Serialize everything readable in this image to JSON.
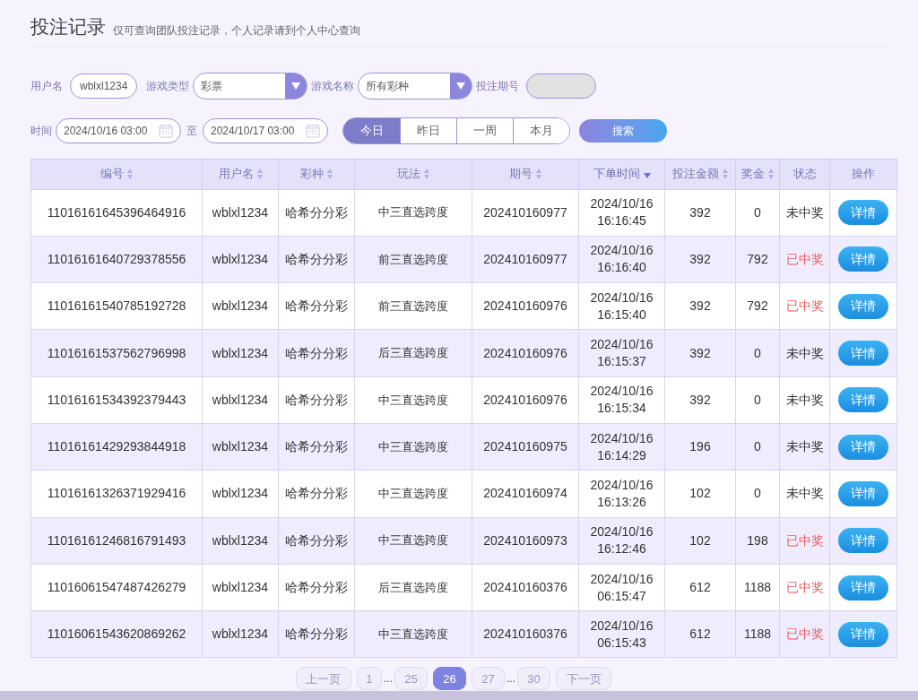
{
  "header": {
    "title": "投注记录",
    "subtitle": "仅可查询团队投注记录，个人记录请到个人中心查询"
  },
  "filters": {
    "username_label": "用户名",
    "username": "wblxl1234",
    "game_type_label": "游戏类型",
    "game_type": "彩票",
    "game_name_label": "游戏名称",
    "game_name": "所有彩种",
    "period_label": "投注期号",
    "time_label": "时间",
    "start_time": "2024/10/16 03:00",
    "to_label": "至",
    "end_time": "2024/10/17 03:00",
    "ranges": [
      {
        "label": "今日",
        "selected": true
      },
      {
        "label": "昨日",
        "selected": false
      },
      {
        "label": "一周",
        "selected": false
      },
      {
        "label": "本月",
        "selected": false
      }
    ],
    "search_button": "搜索"
  },
  "table": {
    "columns": [
      {
        "label": "编号",
        "sortable": true,
        "sorted": false
      },
      {
        "label": "用户名",
        "sortable": true,
        "sorted": false
      },
      {
        "label": "彩种",
        "sortable": true,
        "sorted": false
      },
      {
        "label": "玩法",
        "sortable": true,
        "sorted": false
      },
      {
        "label": "期号",
        "sortable": true,
        "sorted": false
      },
      {
        "label": "下单时间",
        "sortable": true,
        "sorted": true
      },
      {
        "label": "投注金额",
        "sortable": true,
        "sorted": false
      },
      {
        "label": "奖金",
        "sortable": true,
        "sorted": false
      },
      {
        "label": "状态"
      },
      {
        "label": "操作"
      }
    ],
    "rows": [
      {
        "id": "11016161645396464916",
        "user": "wblxl1234",
        "lottery": "哈希分分彩",
        "play": "中三直选跨度",
        "period": "202410160977",
        "date": "2024/10/16",
        "time": "16:16:45",
        "amount": "392",
        "prize": "0",
        "status": "未中奖",
        "won": false,
        "action": "详情"
      },
      {
        "id": "11016161640729378556",
        "user": "wblxl1234",
        "lottery": "哈希分分彩",
        "play": "前三直选跨度",
        "period": "202410160977",
        "date": "2024/10/16",
        "time": "16:16:40",
        "amount": "392",
        "prize": "792",
        "status": "已中奖",
        "won": true,
        "action": "详情"
      },
      {
        "id": "11016161540785192728",
        "user": "wblxl1234",
        "lottery": "哈希分分彩",
        "play": "前三直选跨度",
        "period": "202410160976",
        "date": "2024/10/16",
        "time": "16:15:40",
        "amount": "392",
        "prize": "792",
        "status": "已中奖",
        "won": true,
        "action": "详情"
      },
      {
        "id": "11016161537562796998",
        "user": "wblxl1234",
        "lottery": "哈希分分彩",
        "play": "后三直选跨度",
        "period": "202410160976",
        "date": "2024/10/16",
        "time": "16:15:37",
        "amount": "392",
        "prize": "0",
        "status": "未中奖",
        "won": false,
        "action": "详情"
      },
      {
        "id": "11016161534392379443",
        "user": "wblxl1234",
        "lottery": "哈希分分彩",
        "play": "中三直选跨度",
        "period": "202410160976",
        "date": "2024/10/16",
        "time": "16:15:34",
        "amount": "392",
        "prize": "0",
        "status": "未中奖",
        "won": false,
        "action": "详情"
      },
      {
        "id": "11016161429293844918",
        "user": "wblxl1234",
        "lottery": "哈希分分彩",
        "play": "中三直选跨度",
        "period": "202410160975",
        "date": "2024/10/16",
        "time": "16:14:29",
        "amount": "196",
        "prize": "0",
        "status": "未中奖",
        "won": false,
        "action": "详情"
      },
      {
        "id": "11016161326371929416",
        "user": "wblxl1234",
        "lottery": "哈希分分彩",
        "play": "中三直选跨度",
        "period": "202410160974",
        "date": "2024/10/16",
        "time": "16:13:26",
        "amount": "102",
        "prize": "0",
        "status": "未中奖",
        "won": false,
        "action": "详情"
      },
      {
        "id": "11016161246816791493",
        "user": "wblxl1234",
        "lottery": "哈希分分彩",
        "play": "中三直选跨度",
        "period": "202410160973",
        "date": "2024/10/16",
        "time": "16:12:46",
        "amount": "102",
        "prize": "198",
        "status": "已中奖",
        "won": true,
        "action": "详情"
      },
      {
        "id": "11016061547487426279",
        "user": "wblxl1234",
        "lottery": "哈希分分彩",
        "play": "后三直选跨度",
        "period": "202410160376",
        "date": "2024/10/16",
        "time": "06:15:47",
        "amount": "612",
        "prize": "1188",
        "status": "已中奖",
        "won": true,
        "action": "详情"
      },
      {
        "id": "11016061543620869262",
        "user": "wblxl1234",
        "lottery": "哈希分分彩",
        "play": "中三直选跨度",
        "period": "202410160376",
        "date": "2024/10/16",
        "time": "06:15:43",
        "amount": "612",
        "prize": "1188",
        "status": "已中奖",
        "won": true,
        "action": "详情"
      }
    ]
  },
  "pagination": [
    {
      "kind": "nav",
      "label": "上一页"
    },
    {
      "kind": "page",
      "label": "1",
      "selected": false
    },
    {
      "kind": "gap",
      "label": "..."
    },
    {
      "kind": "page",
      "label": "25",
      "selected": false
    },
    {
      "kind": "page",
      "label": "26",
      "selected": true
    },
    {
      "kind": "page",
      "label": "27",
      "selected": false
    },
    {
      "kind": "gap",
      "label": "..."
    },
    {
      "kind": "page",
      "label": "30",
      "selected": false
    },
    {
      "kind": "nav",
      "label": "下一页"
    }
  ]
}
